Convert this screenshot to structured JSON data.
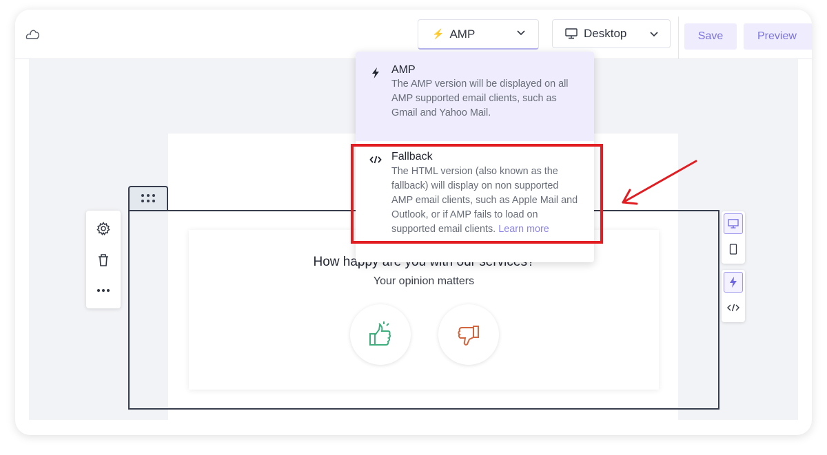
{
  "topbar": {
    "mode_select": {
      "icon": "bolt-icon",
      "value": "AMP",
      "chevron": "chevron-down-icon"
    },
    "device_select": {
      "icon": "monitor-icon",
      "value": "Desktop",
      "chevron": "chevron-down-icon"
    },
    "save_label": "Save",
    "preview_label": "Preview"
  },
  "mode_dropdown": {
    "options": [
      {
        "icon": "bolt-icon",
        "title": "AMP",
        "description": "The AMP version will be displayed on all AMP supported email clients, such as Gmail and Yahoo Mail.",
        "selected": true
      },
      {
        "icon": "code-icon",
        "title": "Fallback",
        "description": "The HTML version (also known as the fallback) will display on non supported AMP email clients, such as Apple Mail and Outlook, or if AMP fails to load on supported email clients.",
        "link_label": "Learn more",
        "selected": false
      }
    ]
  },
  "side_tools": [
    "gear-icon",
    "trash-icon",
    "more-icon"
  ],
  "survey": {
    "title": "How happy are you with our services?",
    "subtitle": "Your opinion matters",
    "buttons": [
      {
        "icon": "thumbs-up-icon",
        "color": "#3fae7d"
      },
      {
        "icon": "thumbs-down-icon",
        "color": "#d2663f"
      }
    ]
  },
  "view_toggles": {
    "device": [
      "monitor-icon",
      "mobile-icon"
    ],
    "version": [
      "bolt-icon",
      "code-icon"
    ]
  },
  "colors": {
    "accent": "#7b73e3",
    "accent_bg": "#efedfd",
    "annotation": "#e11d22"
  }
}
